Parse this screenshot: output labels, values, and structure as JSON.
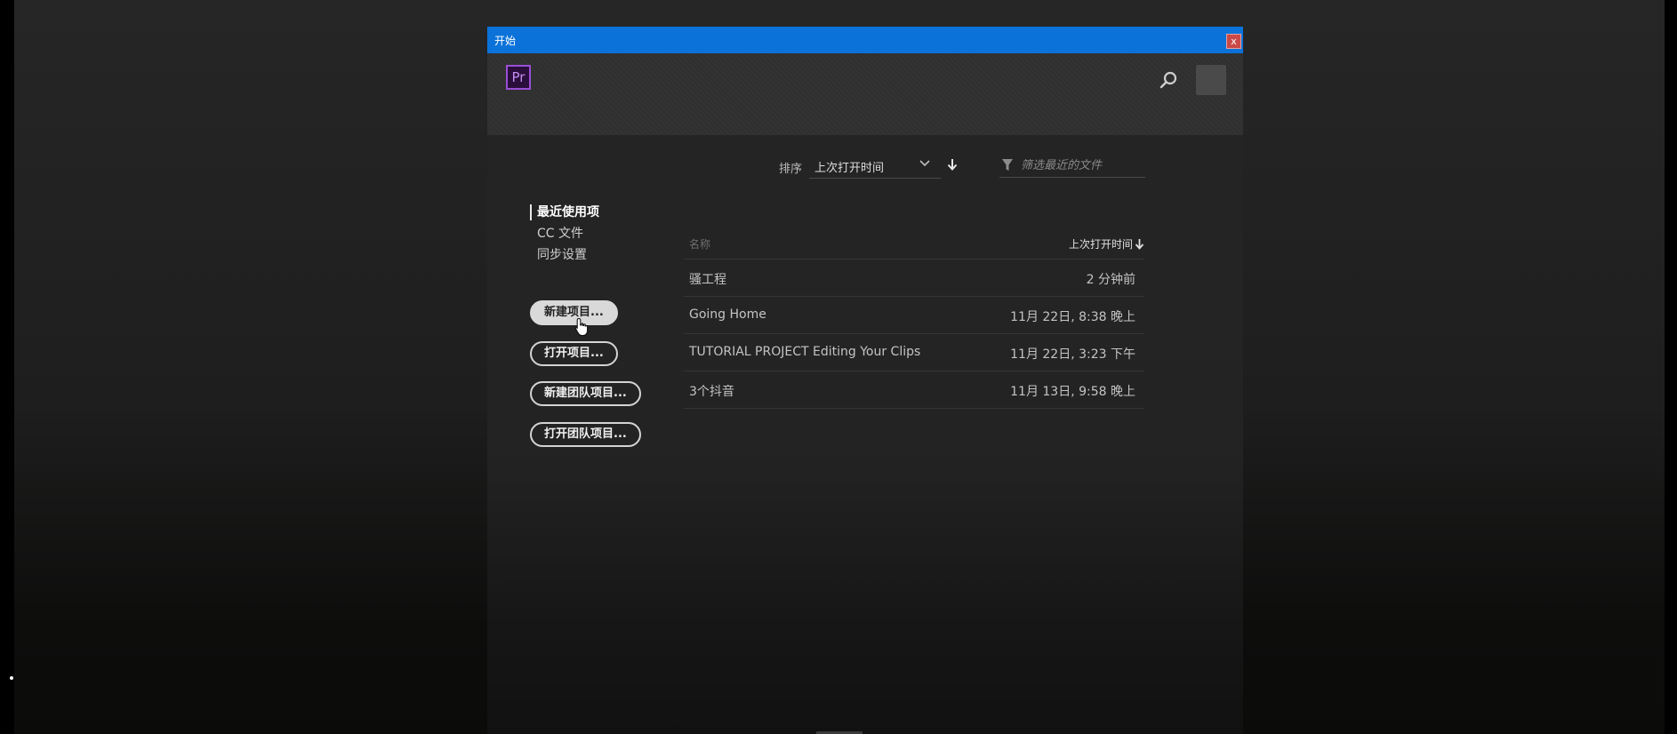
{
  "window": {
    "title": "开始",
    "close_label": "x"
  },
  "header": {
    "logo_text": "Pr"
  },
  "toolbar": {
    "sort_label": "排序",
    "sort_value": "上次打开时间",
    "filter_placeholder": "筛选最近的文件"
  },
  "nav": {
    "items": [
      {
        "label": "最近使用项",
        "active": true
      },
      {
        "label": "CC 文件",
        "active": false
      },
      {
        "label": "同步设置",
        "active": false
      }
    ]
  },
  "buttons": {
    "new_project": "新建项目...",
    "open_project": "打开项目...",
    "new_team_project": "新建团队项目...",
    "open_team_project": "打开团队项目..."
  },
  "table": {
    "col_name": "名称",
    "col_time": "上次打开时间",
    "rows": [
      {
        "name": "骚工程",
        "time": "2 分钟前"
      },
      {
        "name": "Going Home",
        "time": "11月 22日, 8:38 晚上"
      },
      {
        "name": "TUTORIAL PROJECT Editing Your Clips",
        "time": "11月 22日, 3:23 下午"
      },
      {
        "name": "3个抖音",
        "time": "11月 13日, 9:58 晚上"
      }
    ]
  },
  "colors": {
    "titlebar": "#0b72d9",
    "accent_purple": "#9b4fd6",
    "close_red": "#c94a47"
  }
}
